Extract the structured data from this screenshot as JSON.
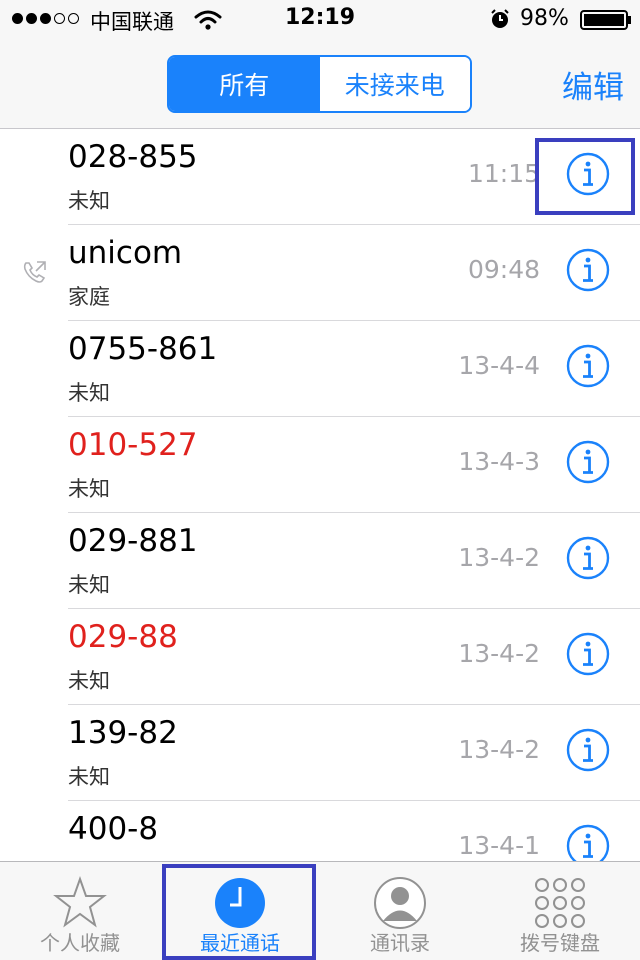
{
  "status_bar": {
    "carrier": "中国联通",
    "time": "12:19",
    "battery": "98%"
  },
  "nav": {
    "segments": [
      "所有",
      "未接来电"
    ],
    "selected_segment": "所有",
    "edit_label": "编辑"
  },
  "calls": [
    {
      "name": "028-855",
      "label": "未知",
      "time": "11:15",
      "missed": false,
      "outgoing": false
    },
    {
      "name": "unicom",
      "label": "家庭",
      "time": "09:48",
      "missed": false,
      "outgoing": true
    },
    {
      "name": "0755-861",
      "label": "未知",
      "time": "13-4-4",
      "missed": false,
      "outgoing": false
    },
    {
      "name": "010-527",
      "label": "未知",
      "time": "13-4-3",
      "missed": true,
      "outgoing": false
    },
    {
      "name": "029-881",
      "label": "未知",
      "time": "13-4-2",
      "missed": false,
      "outgoing": false
    },
    {
      "name": "029-88",
      "label": "未知",
      "time": "13-4-2",
      "missed": true,
      "outgoing": false
    },
    {
      "name": "139-82",
      "label": "未知",
      "time": "13-4-2",
      "missed": false,
      "outgoing": false
    },
    {
      "name": "400-8",
      "label": "",
      "time": "13-4-1",
      "missed": false,
      "outgoing": false
    }
  ],
  "tabs": [
    {
      "label": "个人收藏",
      "icon": "star-icon",
      "active": false
    },
    {
      "label": "最近通话",
      "icon": "clock-icon",
      "active": true
    },
    {
      "label": "通讯录",
      "icon": "contact-icon",
      "active": false
    },
    {
      "label": "拨号键盘",
      "icon": "keypad-icon",
      "active": false
    }
  ],
  "colors": {
    "accent": "#1a82fb",
    "missed": "#e0211d",
    "highlight": "#3a3fbf"
  }
}
